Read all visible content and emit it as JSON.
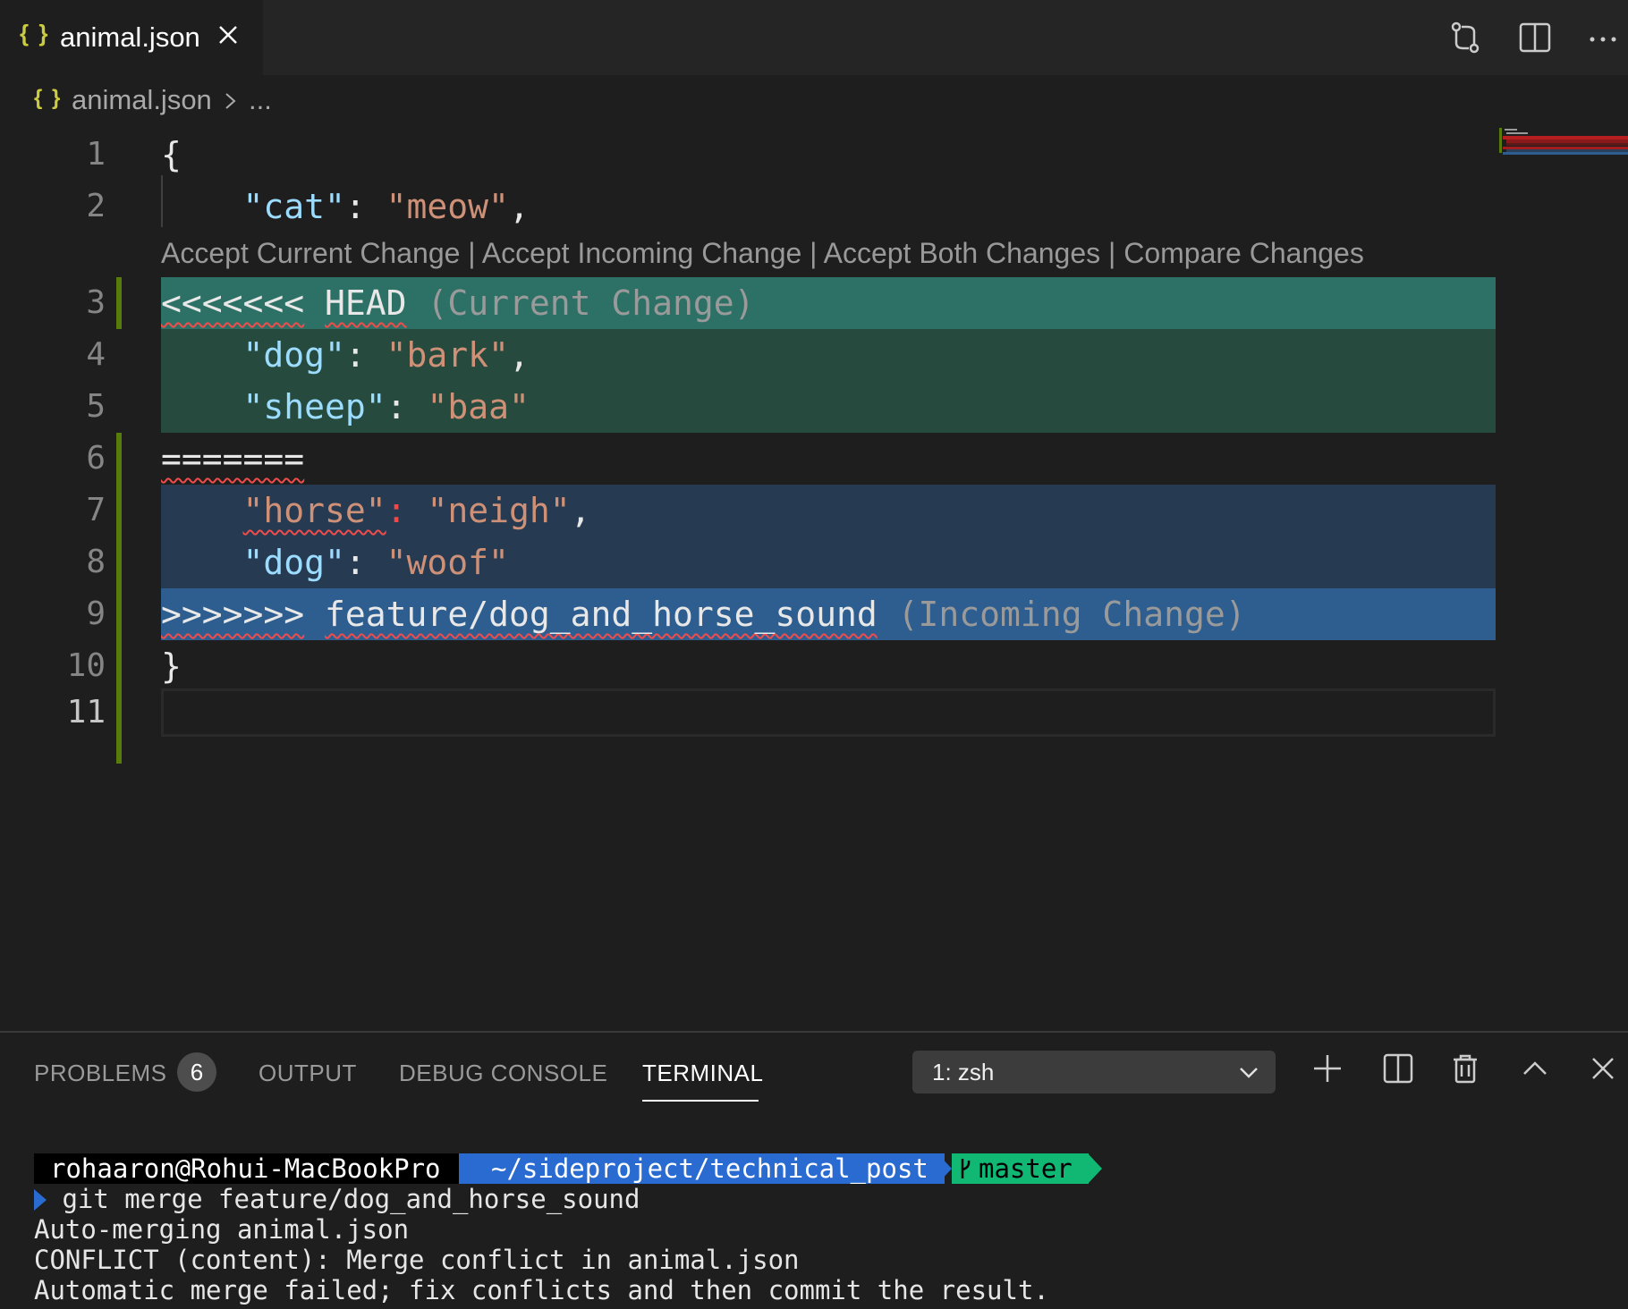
{
  "tab": {
    "icon": "json-braces-icon",
    "icon_text": "{ }",
    "label": "animal.json"
  },
  "toolbar": {
    "icons": [
      "open-changes-icon",
      "split-editor-icon",
      "more-actions-icon"
    ]
  },
  "breadcrumb": {
    "icon_text": "{ }",
    "file": "animal.json",
    "ellipsis": "..."
  },
  "editor": {
    "codelens": "Accept Current Change | Accept Incoming Change | Accept Both Changes | Compare Changes",
    "line_numbers": [
      "1",
      "2",
      "3",
      "4",
      "5",
      "6",
      "7",
      "8",
      "9",
      "10",
      "11"
    ],
    "lines": {
      "l1": "{",
      "l2_key": "\"cat\"",
      "l2_colon": ": ",
      "l2_val": "\"meow\"",
      "l2_end": ",",
      "l3_marker": "<<<<<<<",
      "l3_head": "HEAD",
      "l3_label": "(Current Change)",
      "l4_key": "\"dog\"",
      "l4_colon": ": ",
      "l4_val": "\"bark\"",
      "l4_end": ",",
      "l5_key": "\"sheep\"",
      "l5_colon": ": ",
      "l5_val": "\"baa\"",
      "l6": "=======",
      "l7_key": "\"horse\"",
      "l7_colon": ":",
      "l7_val": "\"neigh\"",
      "l7_end": ",",
      "l8_key": "\"dog\"",
      "l8_colon": ": ",
      "l8_val": "\"woof\"",
      "l9_marker": ">>>>>>>",
      "l9_branch": "feature/dog_and_horse_sound",
      "l9_label": "(Incoming Change)",
      "l10": "}"
    },
    "colors": {
      "current_header": "#2d7166",
      "current_body": "#264a3e",
      "incoming_body": "#263a52",
      "incoming_header": "#2d5e8f"
    }
  },
  "panel": {
    "tabs": {
      "problems": "PROBLEMS",
      "output": "OUTPUT",
      "debug": "DEBUG CONSOLE",
      "terminal": "TERMINAL"
    },
    "problems_count": "6",
    "terminal_select": "1: zsh",
    "icons": [
      "plus-icon",
      "split-terminal-icon",
      "trash-icon",
      "chevron-up-icon",
      "close-icon"
    ]
  },
  "terminal": {
    "user": "rohaaron@Rohui-MacBookPro",
    "path": "~/sideproject/technical_post",
    "branch": "master",
    "command": " git merge feature/dog_and_horse_sound",
    "out1": "Auto-merging animal.json",
    "out2": "CONFLICT (content): Merge conflict in animal.json",
    "out3": "Automatic merge failed; fix conflicts and then commit the result."
  }
}
